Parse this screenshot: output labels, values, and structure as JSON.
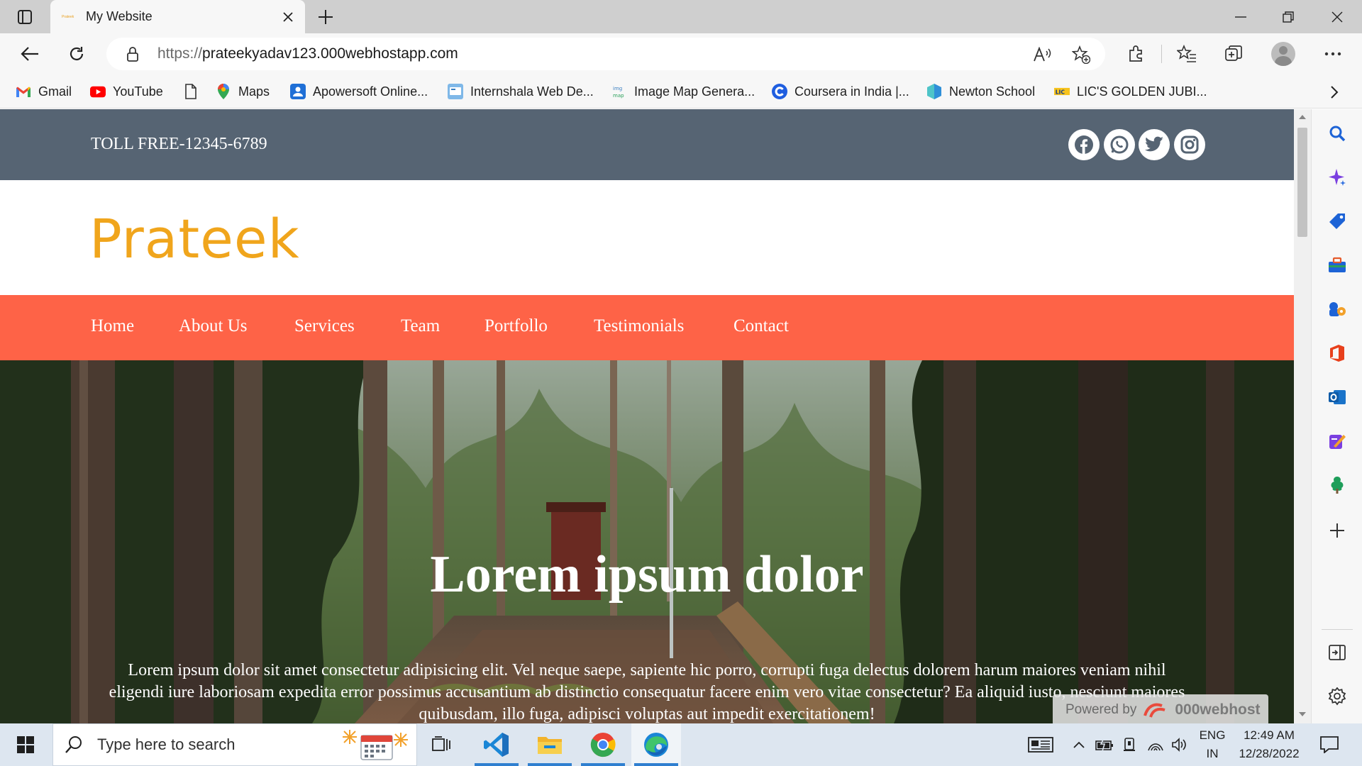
{
  "browser": {
    "tab": {
      "title": "My Website",
      "favicon_text": "Prateek"
    },
    "address": {
      "scheme": "https://",
      "host": "prateekyadav123.000webhostapp.com"
    },
    "bookmarks": [
      {
        "label": "Gmail",
        "icon": "gmail-icon"
      },
      {
        "label": "YouTube",
        "icon": "youtube-icon"
      },
      {
        "label": "",
        "icon": "page-icon"
      },
      {
        "label": "Maps",
        "icon": "maps-icon"
      },
      {
        "label": "Apowersoft Online...",
        "icon": "apowersoft-icon"
      },
      {
        "label": "Internshala Web De...",
        "icon": "internshala-icon"
      },
      {
        "label": "Image Map Genera...",
        "icon": "image-map-icon"
      },
      {
        "label": "Coursera in India |...",
        "icon": "coursera-icon"
      },
      {
        "label": "Newton School",
        "icon": "newton-icon"
      },
      {
        "label": "LIC'S GOLDEN JUBI...",
        "icon": "lic-icon"
      }
    ]
  },
  "site": {
    "toll_free": "TOLL FREE-12345-6789",
    "social": [
      "facebook-icon",
      "whatsapp-icon",
      "twitter-icon",
      "instagram-icon"
    ],
    "logo": "Prateek",
    "menu": [
      "Home",
      "About Us",
      "Services",
      "Team",
      "Portfollo",
      "Testimonials",
      "Contact"
    ],
    "hero": {
      "title": "Lorem ipsum dolor",
      "text": "Lorem ipsum dolor sit amet consectetur adipisicing elit. Vel neque saepe, sapiente hic porro, corrupti fuga delectus dolorem harum maiores veniam nihil eligendi iure laboriosam expedita error possimus accusantium ab distinctio consequatur facere enim vero vitae consectetur? Ea aliquid iusto, nesciunt maiores quibusdam, illo fuga, adipisci voluptas aut impedit exercitationem!"
    },
    "powered_by": {
      "label": "Powered by",
      "brand": "000webhost"
    }
  },
  "taskbar": {
    "search_placeholder": "Type here to search",
    "lang_top": "ENG",
    "lang_bottom": "IN",
    "time": "12:49 AM",
    "date": "12/28/2022"
  },
  "colors": {
    "topbar": "#566473",
    "menubar": "#fe6347",
    "logo": "#f0a51c"
  }
}
